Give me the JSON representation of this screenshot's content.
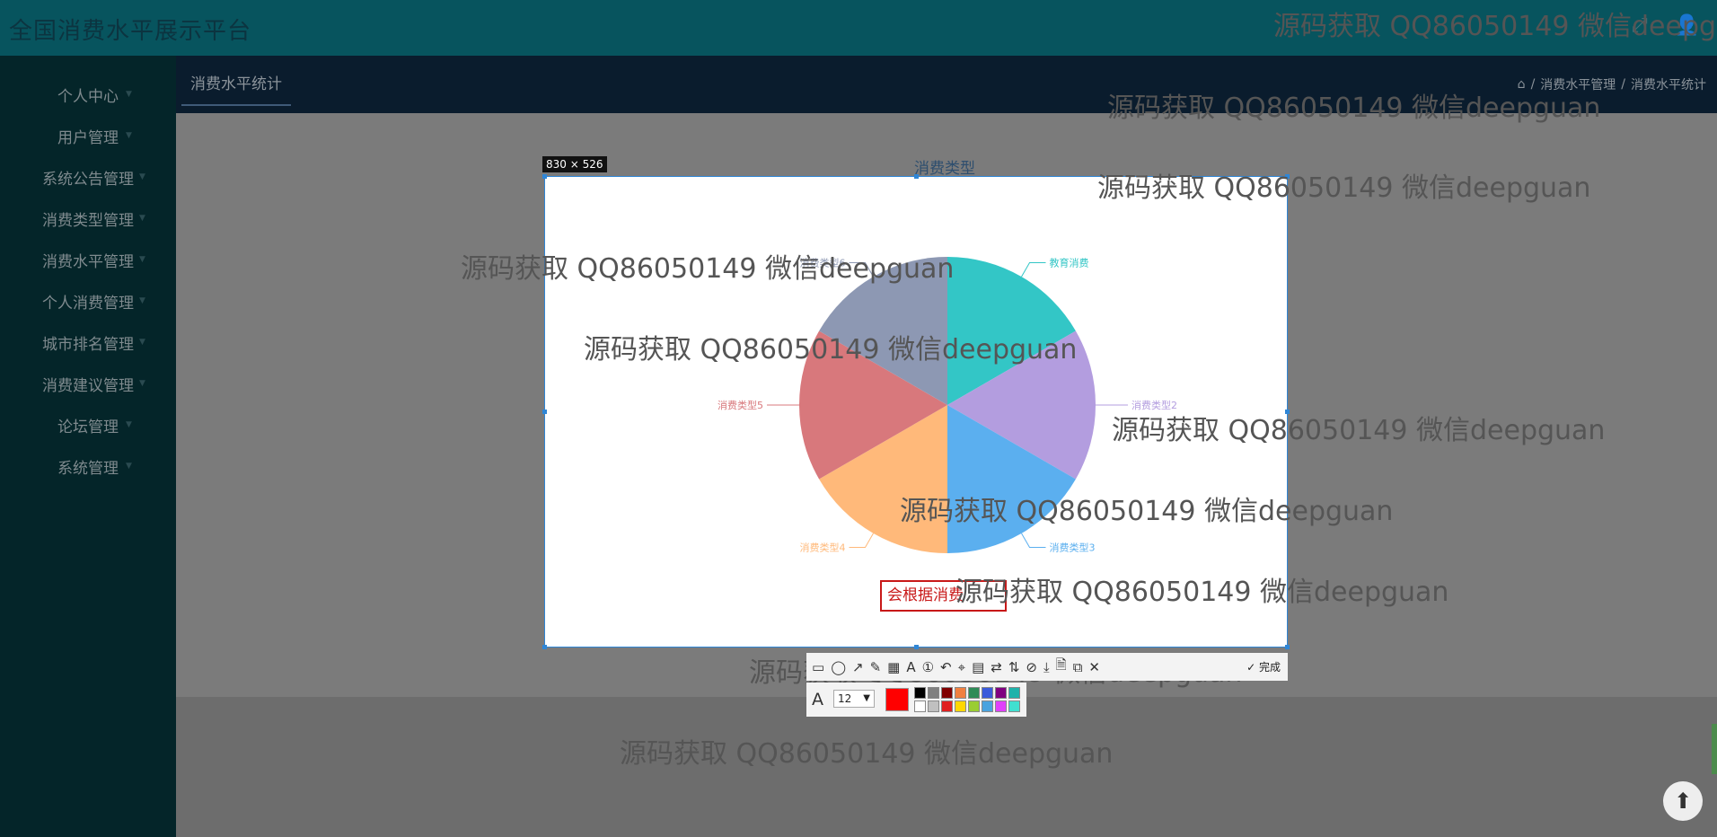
{
  "header": {
    "title": "全国消费水平展示平台"
  },
  "sidebar": {
    "items": [
      {
        "label": "个人中心"
      },
      {
        "label": "用户管理"
      },
      {
        "label": "系统公告管理"
      },
      {
        "label": "消费类型管理"
      },
      {
        "label": "消费水平管理"
      },
      {
        "label": "个人消费管理"
      },
      {
        "label": "城市排名管理"
      },
      {
        "label": "消费建议管理"
      },
      {
        "label": "论坛管理"
      },
      {
        "label": "系统管理"
      }
    ]
  },
  "page": {
    "tab": "消费水平统计",
    "breadcrumb": [
      "消费水平管理",
      "消费水平统计"
    ]
  },
  "capture": {
    "size": "830 × 526",
    "textbox": "会根据消费",
    "font_size": "12",
    "done_label": "完成",
    "current_color": "#ff0000",
    "palette": [
      "#000000",
      "#808080",
      "#800000",
      "#f08040",
      "#2e8b57",
      "#3b5bdb",
      "#800080",
      "#20b2aa",
      "#ffffff",
      "#c0c0c0",
      "#e02020",
      "#ffd700",
      "#9acd32",
      "#4aa3df",
      "#e040fb",
      "#40e0d0"
    ]
  },
  "chart_data": {
    "type": "pie",
    "title": "消费类型",
    "slices": [
      {
        "name": "教育消费",
        "value": 1,
        "color": "#33c6c6"
      },
      {
        "name": "消费类型2",
        "value": 1,
        "color": "#b39ddf"
      },
      {
        "name": "消费类型3",
        "value": 1,
        "color": "#5bafef"
      },
      {
        "name": "消费类型4",
        "value": 1,
        "color": "#ffb97a"
      },
      {
        "name": "消费类型5",
        "value": 1,
        "color": "#d8787c"
      },
      {
        "name": "消费类型6",
        "value": 1,
        "color": "#8d98b3"
      }
    ]
  },
  "watermark": "源码获取 QQ86050149 微信deepguan",
  "icons": [
    "fullscreen-icon",
    "user-icon",
    "home-icon",
    "arrow-up-icon"
  ]
}
